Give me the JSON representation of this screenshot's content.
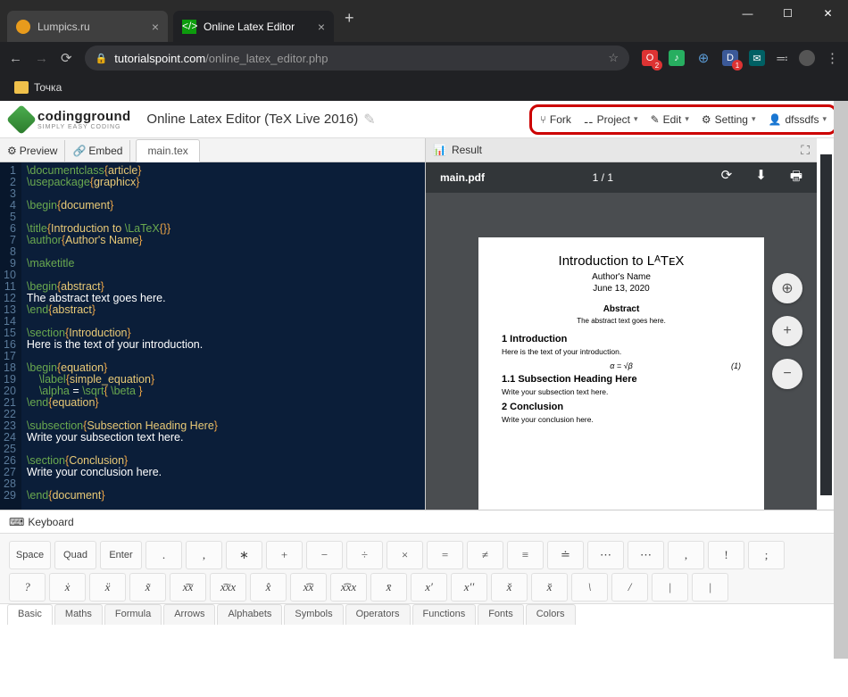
{
  "browser": {
    "tabs": [
      {
        "title": "Lumpics.ru"
      },
      {
        "title": "Online Latex Editor"
      }
    ],
    "url_host": "tutorialspoint.com",
    "url_path": "/online_latex_editor.php",
    "bookmark": "Точка"
  },
  "app": {
    "logo_name": "codingground",
    "logo_sub": "SIMPLY EASY CODING",
    "title": "Online Latex Editor (TeX Live 2016)"
  },
  "top_menu": {
    "fork": "Fork",
    "project": "Project",
    "edit": "Edit",
    "setting": "Setting",
    "user": "dfssdfs"
  },
  "editor": {
    "preview": "Preview",
    "embed": "Embed",
    "file": "main.tex",
    "lines": [
      {
        "n": 1,
        "t": "cmd",
        "c": "\\documentclass",
        "a": "article"
      },
      {
        "n": 2,
        "t": "cmd",
        "c": "\\usepackage",
        "a": "graphicx"
      },
      {
        "n": 3,
        "t": "blank"
      },
      {
        "n": 4,
        "t": "cmd",
        "c": "\\begin",
        "a": "document"
      },
      {
        "n": 5,
        "t": "blank"
      },
      {
        "n": 6,
        "t": "title",
        "c": "\\title",
        "a1": "Introduction to ",
        "a2": "\\LaTeX",
        "a3": "{}"
      },
      {
        "n": 7,
        "t": "cmd",
        "c": "\\author",
        "a": "Author's Name"
      },
      {
        "n": 8,
        "t": "blank"
      },
      {
        "n": 9,
        "t": "plain",
        "c": "\\maketitle"
      },
      {
        "n": 10,
        "t": "blank"
      },
      {
        "n": 11,
        "t": "cmd",
        "c": "\\begin",
        "a": "abstract"
      },
      {
        "n": 12,
        "t": "text",
        "c": "The abstract text goes here."
      },
      {
        "n": 13,
        "t": "cmd",
        "c": "\\end",
        "a": "abstract"
      },
      {
        "n": 14,
        "t": "blank"
      },
      {
        "n": 15,
        "t": "cmd",
        "c": "\\section",
        "a": "Introduction"
      },
      {
        "n": 16,
        "t": "text",
        "c": "Here is the text of your introduction."
      },
      {
        "n": 17,
        "t": "blank"
      },
      {
        "n": 18,
        "t": "cmd",
        "c": "\\begin",
        "a": "equation"
      },
      {
        "n": 19,
        "t": "cmdind",
        "c": "\\label",
        "a": "simple_equation"
      },
      {
        "n": 20,
        "t": "eq",
        "c": "\\alpha",
        " o": " = ",
        "c2": "\\sqrt",
        "a": " \\beta "
      },
      {
        "n": 21,
        "t": "cmd",
        "c": "\\end",
        "a": "equation"
      },
      {
        "n": 22,
        "t": "blank"
      },
      {
        "n": 23,
        "t": "cmd",
        "c": "\\subsection",
        "a": "Subsection Heading Here"
      },
      {
        "n": 24,
        "t": "text",
        "c": "Write your subsection text here."
      },
      {
        "n": 25,
        "t": "blank"
      },
      {
        "n": 26,
        "t": "cmd",
        "c": "\\section",
        "a": "Conclusion"
      },
      {
        "n": 27,
        "t": "text",
        "c": "Write your conclusion here."
      },
      {
        "n": 28,
        "t": "blank"
      },
      {
        "n": 29,
        "t": "cmd",
        "c": "\\end",
        "a": "document"
      }
    ]
  },
  "result": {
    "label": "Result",
    "pdf_name": "main.pdf",
    "page": "1 / 1",
    "doc": {
      "title": "Introduction to LᴬTᴇX",
      "author": "Author's Name",
      "date": "June 13, 2020",
      "abstract_h": "Abstract",
      "abstract_t": "The abstract text goes here.",
      "sec1": "1   Introduction",
      "body1": "Here is the text of your introduction.",
      "eq": "α = √β",
      "eq_num": "(1)",
      "sec11": "1.1   Subsection Heading Here",
      "body11": "Write your subsection text here.",
      "sec2": "2   Conclusion",
      "body2": "Write your conclusion here."
    }
  },
  "keyboard": {
    "label": "Keyboard",
    "row1": [
      "Space",
      "Quad",
      "Enter",
      ".",
      ",",
      "∗",
      "+",
      "−",
      "÷",
      "×",
      "=",
      "≠",
      "≡",
      "≐",
      "⋯",
      "⋯",
      ",",
      "!",
      ";"
    ],
    "row2": [
      "?",
      "ẋ",
      "ẍ",
      "x̃",
      "x͠x",
      "x͠xx",
      "x̂",
      "x͡x",
      "x͡xx",
      "x̄",
      "x′",
      "x′′",
      "x̌",
      "x̆",
      "\\",
      "/",
      "|",
      "|"
    ],
    "tabs": [
      "Basic",
      "Maths",
      "Formula",
      "Arrows",
      "Alphabets",
      "Symbols",
      "Operators",
      "Functions",
      "Fonts",
      "Colors"
    ]
  }
}
